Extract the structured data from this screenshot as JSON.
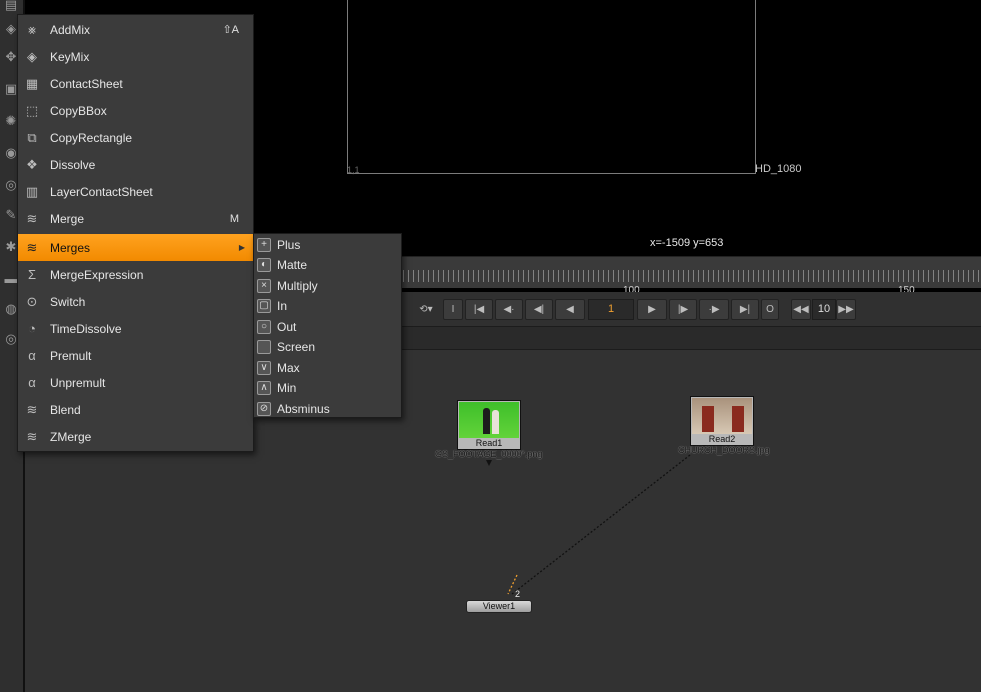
{
  "viewer": {
    "format_name": "HD_1080",
    "corner_label": "1,1",
    "coordinates": "x=-1509 y=653"
  },
  "timeline": {
    "ticks": [
      "100",
      "150"
    ],
    "current_frame": "1",
    "in_label": "I",
    "out_label": "O",
    "increment": "10"
  },
  "menu": {
    "items": [
      {
        "label": "AddMix",
        "shortcut": "⇧A",
        "icon": "addmix-icon"
      },
      {
        "label": "KeyMix",
        "shortcut": "",
        "icon": "keymix-icon"
      },
      {
        "label": "ContactSheet",
        "shortcut": "",
        "icon": "contactsheet-icon"
      },
      {
        "label": "CopyBBox",
        "shortcut": "",
        "icon": "copybbox-icon"
      },
      {
        "label": "CopyRectangle",
        "shortcut": "",
        "icon": "copyrectangle-icon"
      },
      {
        "label": "Dissolve",
        "shortcut": "",
        "icon": "dissolve-icon"
      },
      {
        "label": "LayerContactSheet",
        "shortcut": "",
        "icon": "layercontactsheet-icon"
      },
      {
        "label": "Merge",
        "shortcut": "M",
        "icon": "merge-icon"
      },
      {
        "label": "Merges",
        "shortcut": "",
        "icon": "merges-icon"
      },
      {
        "label": "MergeExpression",
        "shortcut": "",
        "icon": "mergeexpression-icon"
      },
      {
        "label": "Switch",
        "shortcut": "",
        "icon": "switch-icon"
      },
      {
        "label": "TimeDissolve",
        "shortcut": "",
        "icon": "timedissolve-icon"
      },
      {
        "label": "Premult",
        "shortcut": "",
        "icon": "premult-icon"
      },
      {
        "label": "Unpremult",
        "shortcut": "",
        "icon": "unpremult-icon"
      },
      {
        "label": "Blend",
        "shortcut": "",
        "icon": "blend-icon"
      },
      {
        "label": "ZMerge",
        "shortcut": "",
        "icon": "zmerge-icon"
      }
    ],
    "active_index": 8
  },
  "submenu": {
    "items": [
      {
        "label": "Plus",
        "glyph": "+"
      },
      {
        "label": "Matte",
        "glyph": "◐"
      },
      {
        "label": "Multiply",
        "glyph": "×"
      },
      {
        "label": "In",
        "glyph": "▢"
      },
      {
        "label": "Out",
        "glyph": "○"
      },
      {
        "label": "Screen",
        "glyph": ""
      },
      {
        "label": "Max",
        "glyph": "∨"
      },
      {
        "label": "Min",
        "glyph": "∧"
      },
      {
        "label": "Absminus",
        "glyph": "⊘"
      }
    ]
  },
  "nodes": {
    "read1": {
      "name": "Read1",
      "file": "GS_FOOTAGE_0000*.png"
    },
    "read2": {
      "name": "Read2",
      "file": "CHURCH_DOORS.jpg"
    },
    "viewer": {
      "name": "Viewer1",
      "pipe": "2"
    }
  }
}
